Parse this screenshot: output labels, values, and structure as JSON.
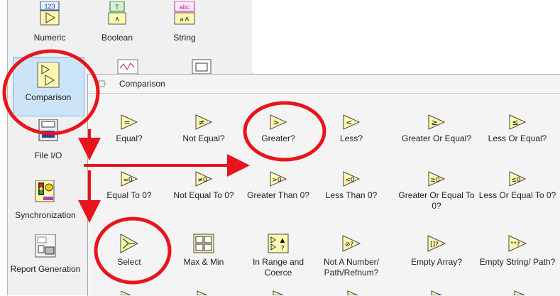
{
  "palette": {
    "items": [
      {
        "label": "Numeric"
      },
      {
        "label": "Boolean"
      },
      {
        "label": "String"
      },
      {
        "label": "Comparison"
      },
      {
        "label": "File I/O"
      },
      {
        "label": "Synchronization"
      },
      {
        "label": "Report Generation"
      }
    ],
    "icon_texts": {
      "numeric": "123",
      "boolean": "TF",
      "string": "abc"
    }
  },
  "popup": {
    "title": "Comparison",
    "rows": [
      [
        {
          "label": "Equal?",
          "glyph": "="
        },
        {
          "label": "Not Equal?",
          "glyph": "≠"
        },
        {
          "label": "Greater?",
          "glyph": ">"
        },
        {
          "label": "Less?",
          "glyph": "<"
        },
        {
          "label": "Greater Or Equal?",
          "glyph": "≥"
        },
        {
          "label": "Less Or Equal?",
          "glyph": "≤"
        }
      ],
      [
        {
          "label": "Equal To 0?",
          "glyph": "=0"
        },
        {
          "label": "Not Equal To 0?",
          "glyph": "≠0"
        },
        {
          "label": "Greater Than 0?",
          "glyph": ">0"
        },
        {
          "label": "Less Than 0?",
          "glyph": "<0"
        },
        {
          "label": "Greater Or Equal To 0?",
          "glyph": "≥0"
        },
        {
          "label": "Less Or Equal To 0?",
          "glyph": "≤0"
        }
      ],
      [
        {
          "label": "Select",
          "glyph": "sel"
        },
        {
          "label": "Max & Min",
          "glyph": "mm"
        },
        {
          "label": "In Range and Coerce",
          "glyph": "rng"
        },
        {
          "label": "Not A Number/ Path/Refnum?",
          "glyph": "⊘?"
        },
        {
          "label": "Empty Array?",
          "glyph": "[]?"
        },
        {
          "label": "Empty String/ Path?",
          "glyph": "\"\"?"
        }
      ]
    ]
  },
  "colors": {
    "annotation": "#e8141a",
    "icon_fill": "#fff9b0",
    "icon_stroke": "#4a4a4a",
    "selection": "#cce4f7"
  }
}
